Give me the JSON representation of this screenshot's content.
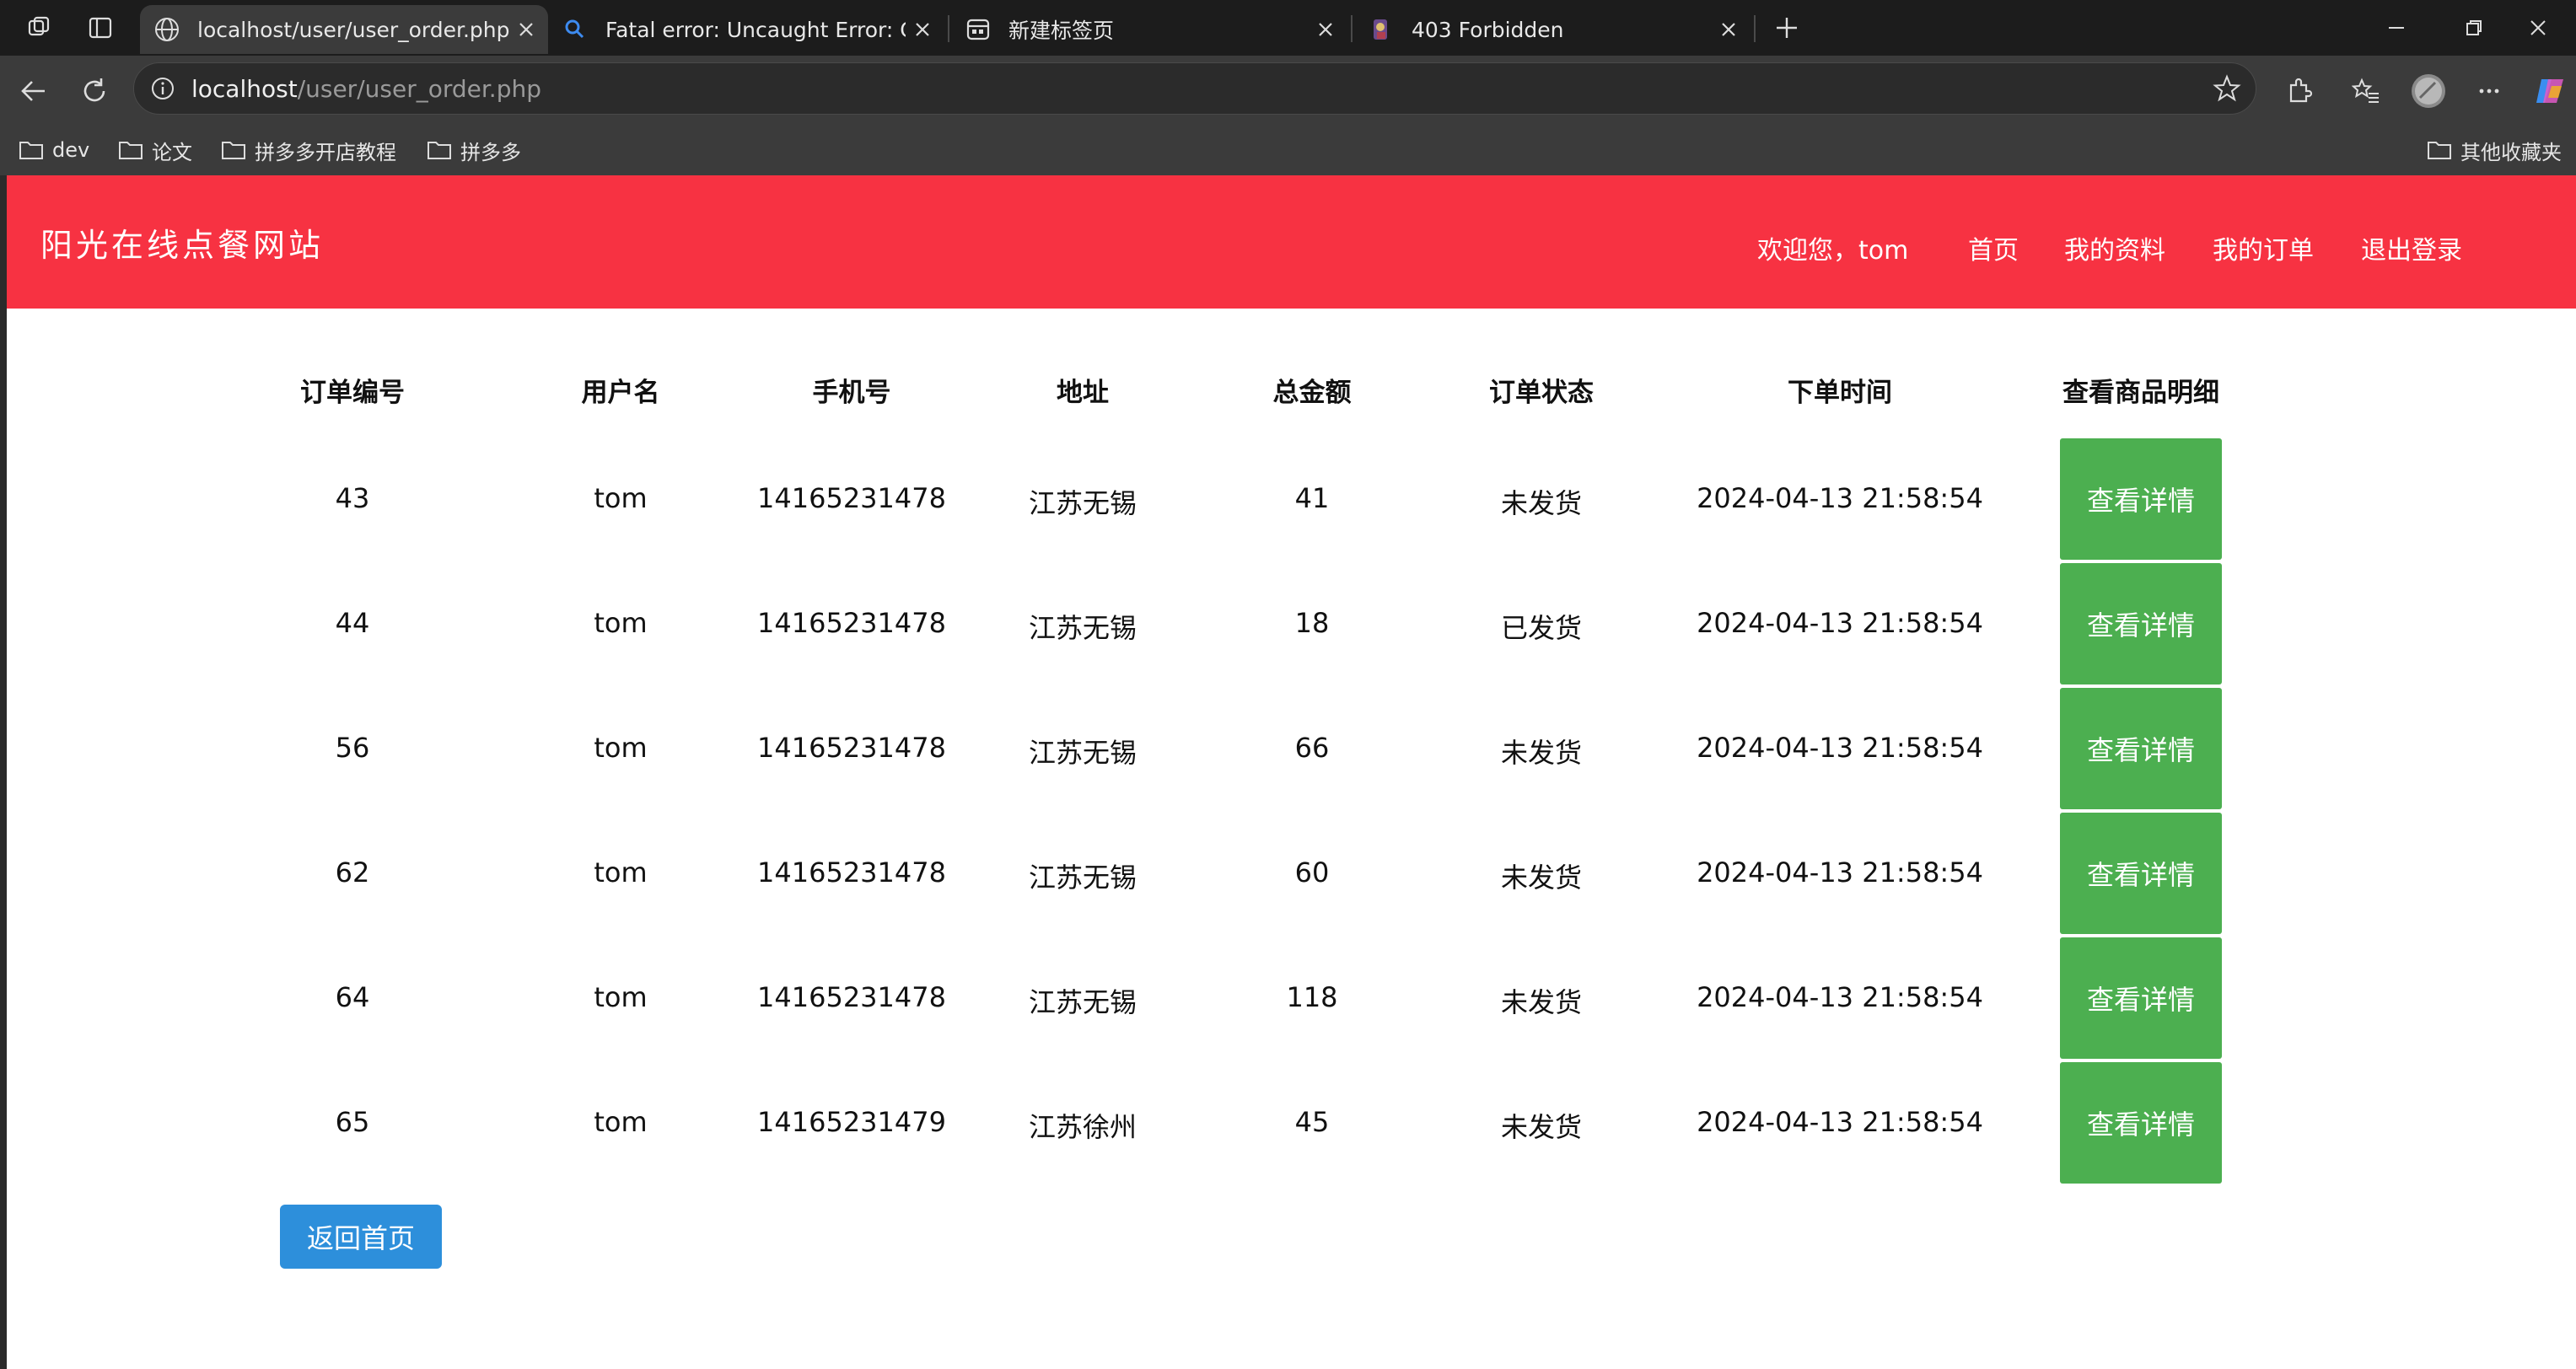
{
  "browser": {
    "tabs": [
      {
        "title": "localhost/user/user_order.php",
        "icon": "globe-icon",
        "active": true
      },
      {
        "title": "Fatal error: Uncaught Error: Call to",
        "icon": "search-icon",
        "active": false
      },
      {
        "title": "新建标签页",
        "icon": "newtab-icon",
        "active": false
      },
      {
        "title": "403 Forbidden",
        "icon": "site-favicon",
        "active": false
      }
    ],
    "url_host": "localhost",
    "url_path": "/user/user_order.php",
    "bookmarks": [
      "dev",
      "论文",
      "拼多多开店教程",
      "拼多多"
    ],
    "other_bookmarks": "其他收藏夹"
  },
  "site": {
    "title": "阳光在线点餐网站",
    "header_color": "#f73242",
    "nav": {
      "welcome": "欢迎您，tom",
      "home": "首页",
      "profile": "我的资料",
      "orders": "我的订单",
      "logout": "退出登录"
    }
  },
  "orders": {
    "columns": [
      "订单编号",
      "用户名",
      "手机号",
      "地址",
      "总金额",
      "订单状态",
      "下单时间",
      "查看商品明细"
    ],
    "rows": [
      {
        "id": "43",
        "user": "tom",
        "phone": "14165231478",
        "address": "江苏无锡",
        "total": "41",
        "status": "未发货",
        "time": "2024-04-13 21:58:54",
        "action": "查看详情"
      },
      {
        "id": "44",
        "user": "tom",
        "phone": "14165231478",
        "address": "江苏无锡",
        "total": "18",
        "status": "已发货",
        "time": "2024-04-13 21:58:54",
        "action": "查看详情"
      },
      {
        "id": "56",
        "user": "tom",
        "phone": "14165231478",
        "address": "江苏无锡",
        "total": "66",
        "status": "未发货",
        "time": "2024-04-13 21:58:54",
        "action": "查看详情"
      },
      {
        "id": "62",
        "user": "tom",
        "phone": "14165231478",
        "address": "江苏无锡",
        "total": "60",
        "status": "未发货",
        "time": "2024-04-13 21:58:54",
        "action": "查看详情"
      },
      {
        "id": "64",
        "user": "tom",
        "phone": "14165231478",
        "address": "江苏无锡",
        "total": "118",
        "status": "未发货",
        "time": "2024-04-13 21:58:54",
        "action": "查看详情"
      },
      {
        "id": "65",
        "user": "tom",
        "phone": "14165231479",
        "address": "江苏徐州",
        "total": "45",
        "status": "未发货",
        "time": "2024-04-13 21:58:54",
        "action": "查看详情"
      }
    ],
    "back_button": "返回首页",
    "button_color": "#4caf50",
    "back_color": "#2d8fdb"
  }
}
